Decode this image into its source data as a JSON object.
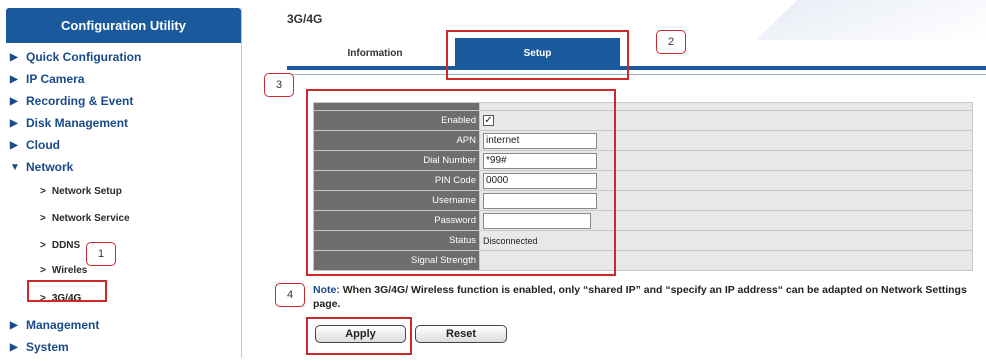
{
  "sidebar": {
    "title": "Configuration Utility",
    "items": [
      {
        "label": "Quick Configuration",
        "expanded": false
      },
      {
        "label": "IP Camera",
        "expanded": false
      },
      {
        "label": "Recording & Event",
        "expanded": false
      },
      {
        "label": "Disk Management",
        "expanded": false
      },
      {
        "label": "Cloud",
        "expanded": false
      },
      {
        "label": "Network",
        "expanded": true
      },
      {
        "label": "Management",
        "expanded": false
      },
      {
        "label": "System",
        "expanded": false
      }
    ],
    "network_subitems": [
      {
        "label": "Network Setup"
      },
      {
        "label": "Network Service"
      },
      {
        "label": "DDNS"
      },
      {
        "label": "Wireles"
      },
      {
        "label": "3G/4G",
        "active": true
      }
    ],
    "collapsed_glyph": "▶",
    "expanded_glyph": "▼",
    "sub_glyph": ">"
  },
  "main": {
    "title": "3G/4G",
    "tabs": [
      {
        "label": "Information",
        "active": false
      },
      {
        "label": "Setup",
        "active": true
      }
    ],
    "form": {
      "enabled_label": "Enabled",
      "enabled_checked": true,
      "apn_label": "APN",
      "apn_value": "internet",
      "dial_label": "Dial Number",
      "dial_value": "*99#",
      "pin_label": "PIN Code",
      "pin_value": "0000",
      "username_label": "Username",
      "username_value": "",
      "password_label": "Password",
      "password_value": "",
      "status_label": "Status",
      "status_value": "Disconnected",
      "signal_label": "Signal Strength",
      "signal_value": ""
    },
    "note_label": "Note:",
    "note_text": "When 3G/4G/ Wireless function is enabled, only “shared IP” and “specify an IP address“ can be adapted on Network Settings page.",
    "apply_label": "Apply",
    "reset_label": "Reset"
  },
  "annotations": [
    "1",
    "2",
    "3",
    "4"
  ],
  "colors": {
    "accent": "#1a5a9c",
    "callout": "#cc2a2a",
    "label_bg": "#6e6e6e",
    "value_bg": "#e8e8e8"
  }
}
